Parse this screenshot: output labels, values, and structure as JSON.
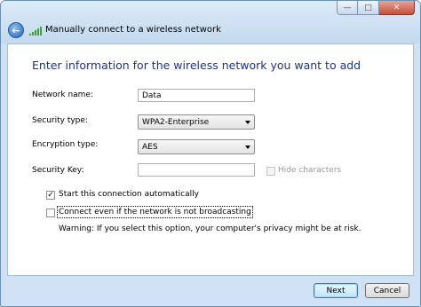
{
  "window": {
    "title": "Manually connect to a wireless network",
    "caption_buttons": [
      {
        "name": "minimize-button",
        "glyph": "—"
      },
      {
        "name": "maximize-button",
        "glyph": "□"
      },
      {
        "name": "close-button",
        "glyph": "✕"
      }
    ]
  },
  "form": {
    "heading": "Enter information for the wireless network you want to add",
    "network_name_label": "Network name:",
    "network_name_value": "Data",
    "security_type_label": "Security type:",
    "security_type_value": "WPA2-Enterprise",
    "encryption_type_label": "Encryption type:",
    "encryption_type_value": "AES",
    "security_key_label": "Security Key:",
    "security_key_value": "",
    "hide_characters_label": "Hide characters",
    "hide_characters_checked": false,
    "start_auto_label": "Start this connection automatically",
    "start_auto_checked": true,
    "connect_even_label": "Connect even if the network is not broadcasting",
    "connect_even_checked": false,
    "warning": "Warning: If you select this option, your computer's privacy might be at risk."
  },
  "buttons": {
    "next": "Next",
    "cancel": "Cancel"
  },
  "icons": {
    "back": "back-arrow-icon",
    "signal": "wireless-signal-icon"
  },
  "colors": {
    "heading": "#1e3287",
    "frame": "#cfe1f2"
  }
}
